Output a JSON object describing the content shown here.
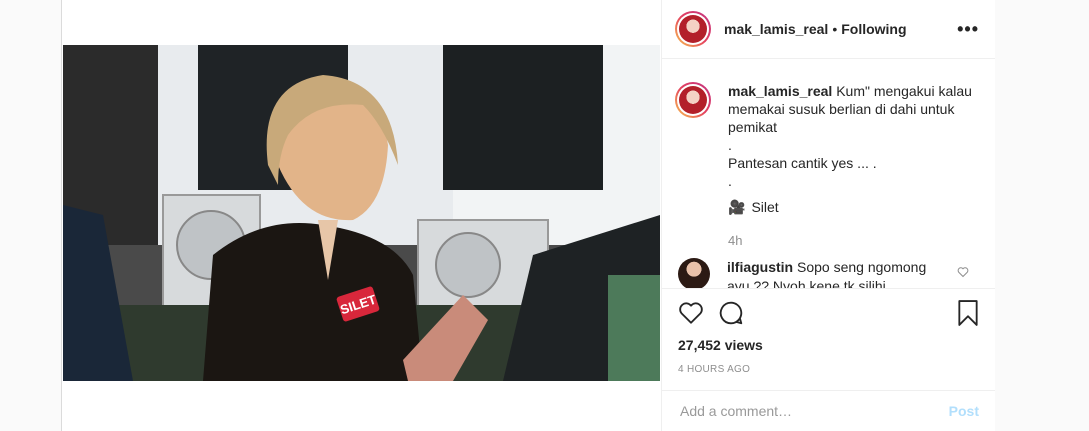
{
  "header": {
    "username": "mak_lamis_real",
    "separator": "•",
    "following_label": "Following",
    "more_label": "•••"
  },
  "caption": {
    "username": "mak_lamis_real",
    "lines": [
      "Kum\" mengakui kalau",
      "memakai susuk berlian di dahi untuk",
      "pemikat",
      ".",
      "Pantesan cantik yes ... .",
      "."
    ],
    "channel_label": "Silet",
    "time": "4h"
  },
  "comments": [
    {
      "username": "ilfiagustin",
      "text": "Sopo seng ngomong ayu ?? Nyoh kene tk silihi"
    }
  ],
  "video": {
    "mic_logo": "SILET"
  },
  "stats": {
    "views": "27,452 views",
    "posted": "4 HOURS AGO"
  },
  "add_comment": {
    "placeholder": "Add a comment…",
    "post_label": "Post"
  },
  "colors": {
    "link_disabled": "#b2dffc",
    "muted": "#8e8e8e",
    "text": "#262626"
  }
}
